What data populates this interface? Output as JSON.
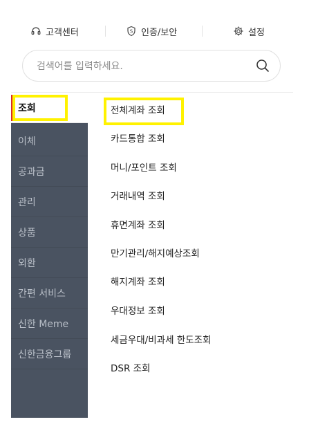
{
  "topbar": {
    "items": [
      {
        "label": "고객센터",
        "icon": "headset-icon"
      },
      {
        "label": "인증/보안",
        "icon": "shield-icon"
      },
      {
        "label": "설정",
        "icon": "gear-icon"
      }
    ]
  },
  "search": {
    "placeholder": "검색어를 입력하세요.",
    "value": "",
    "icon": "search-icon"
  },
  "sidebar": {
    "active_index": 0,
    "items": [
      {
        "label": "조회"
      },
      {
        "label": "이체"
      },
      {
        "label": "공과금"
      },
      {
        "label": "관리"
      },
      {
        "label": "상품"
      },
      {
        "label": "외환"
      },
      {
        "label": "간편 서비스"
      },
      {
        "label": "신한 Meme"
      },
      {
        "label": "신한금융그룹"
      }
    ]
  },
  "submenu": {
    "active_index": 0,
    "items": [
      {
        "label": "전체계좌 조회"
      },
      {
        "label": "카드통합 조회"
      },
      {
        "label": "머니/포인트 조회"
      },
      {
        "label": "거래내역 조회"
      },
      {
        "label": "휴면계좌 조회"
      },
      {
        "label": "만기관리/해지예상조회"
      },
      {
        "label": "해지계좌 조회"
      },
      {
        "label": "우대정보 조회"
      },
      {
        "label": "세금우대/비과세 한도조회"
      },
      {
        "label": "DSR 조회"
      }
    ]
  },
  "colors": {
    "sidebar_bg": "#4a5361",
    "highlight": "#fff200",
    "active_marker": "#d92b2b"
  }
}
